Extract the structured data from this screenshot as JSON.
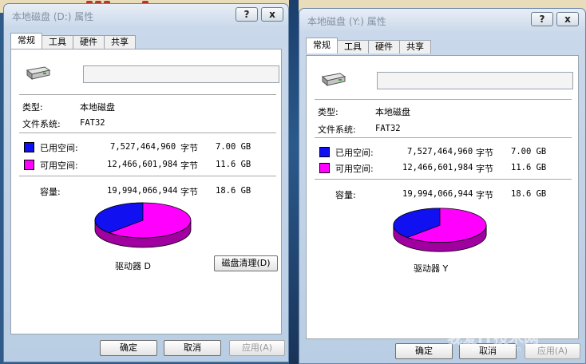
{
  "colors": {
    "used": "#1010f0",
    "free": "#ff00ff"
  },
  "left": {
    "title": "本地磁盘 (D:) 属性",
    "controls": {
      "help": "?",
      "close": "x"
    },
    "tabs": [
      "常规",
      "工具",
      "硬件",
      "共享"
    ],
    "type_label": "类型:",
    "type_value": "本地磁盘",
    "fs_label": "文件系统:",
    "fs_value": "FAT32",
    "used_label": "已用空间:",
    "used_bytes": "7,527,464,960",
    "used_unit": "字节",
    "used_size": "7.00 GB",
    "free_label": "可用空间:",
    "free_bytes": "12,466,601,984",
    "free_unit": "字节",
    "free_size": "11.6 GB",
    "cap_label": "容量:",
    "cap_bytes": "19,994,066,944",
    "cap_unit": "字节",
    "cap_size": "18.6 GB",
    "used_fraction": 0.3765,
    "drive_label": "驱动器 D",
    "cleanup_button": "磁盘清理(D)",
    "ok_button": "确定",
    "cancel_button": "取消",
    "apply_button": "应用(A)"
  },
  "right": {
    "title": "本地磁盘 (Y:) 属性",
    "controls": {
      "help": "?",
      "close": "x"
    },
    "tabs": [
      "常规",
      "工具",
      "硬件",
      "共享"
    ],
    "type_label": "类型:",
    "type_value": "本地磁盘",
    "fs_label": "文件系统:",
    "fs_value": "FAT32",
    "used_label": "已用空间:",
    "used_bytes": "7,527,464,960",
    "used_unit": "字节",
    "used_size": "7.00 GB",
    "free_label": "可用空间:",
    "free_bytes": "12,466,601,984",
    "free_unit": "字节",
    "free_size": "11.6 GB",
    "cap_label": "容量:",
    "cap_bytes": "19,994,066,944",
    "cap_unit": "字节",
    "cap_size": "18.6 GB",
    "used_fraction": 0.3765,
    "drive_label": "驱动器 Y",
    "ok_button": "确定",
    "cancel_button": "取消",
    "apply_button": "应用(A)"
  },
  "watermark": {
    "text": "我爱IT技术网",
    "sub": "www.52ij.com"
  }
}
